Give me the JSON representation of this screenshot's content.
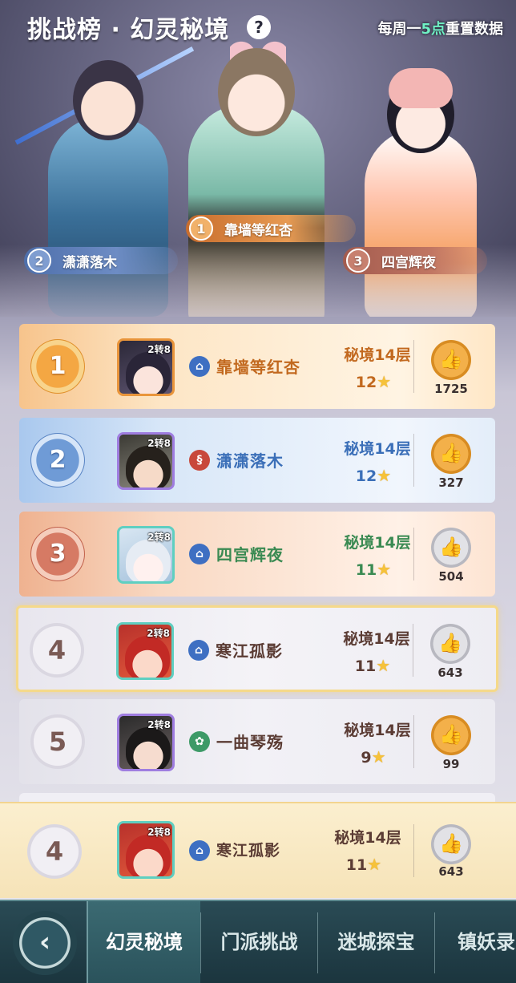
{
  "header": {
    "title": "挑战榜 · 幻灵秘境",
    "help_label": "?",
    "reset_prefix": "每周一",
    "reset_highlight": "5点",
    "reset_suffix": "重置数据"
  },
  "podium": [
    {
      "rank": "1",
      "name": "靠墙等红杏"
    },
    {
      "rank": "2",
      "name": "潇潇落木"
    },
    {
      "rank": "3",
      "name": "四宫辉夜"
    }
  ],
  "rows": [
    {
      "rank": "1",
      "tier": "2转8",
      "name": "靠墙等红杏",
      "realm": "秘境14层",
      "stars": "12",
      "likes": "1725"
    },
    {
      "rank": "2",
      "tier": "2转8",
      "name": "潇潇落木",
      "realm": "秘境14层",
      "stars": "12",
      "likes": "327"
    },
    {
      "rank": "3",
      "tier": "2转8",
      "name": "四宫辉夜",
      "realm": "秘境14层",
      "stars": "11",
      "likes": "504"
    },
    {
      "rank": "4",
      "tier": "2转8",
      "name": "寒江孤影",
      "realm": "秘境14层",
      "stars": "11",
      "likes": "643"
    },
    {
      "rank": "5",
      "tier": "2转8",
      "name": "一曲琴殇",
      "realm": "秘境14层",
      "stars": "9",
      "likes": "99"
    }
  ],
  "my_rank": {
    "rank": "4",
    "tier": "2转8",
    "name": "寒江孤影",
    "realm": "秘境14层",
    "stars": "11",
    "likes": "643"
  },
  "nav": {
    "back_icon": "back-arrow-icon",
    "tabs": [
      "幻灵秘境",
      "门派挑战",
      "迷城探宝",
      "镇妖录"
    ],
    "active": 0
  },
  "colors": {
    "gold": "#f4a743",
    "silver": "#6f9bd6",
    "bronze": "#d67a64",
    "highlight_border": "#f5d98a",
    "nav_bg": "#2a4b55"
  }
}
